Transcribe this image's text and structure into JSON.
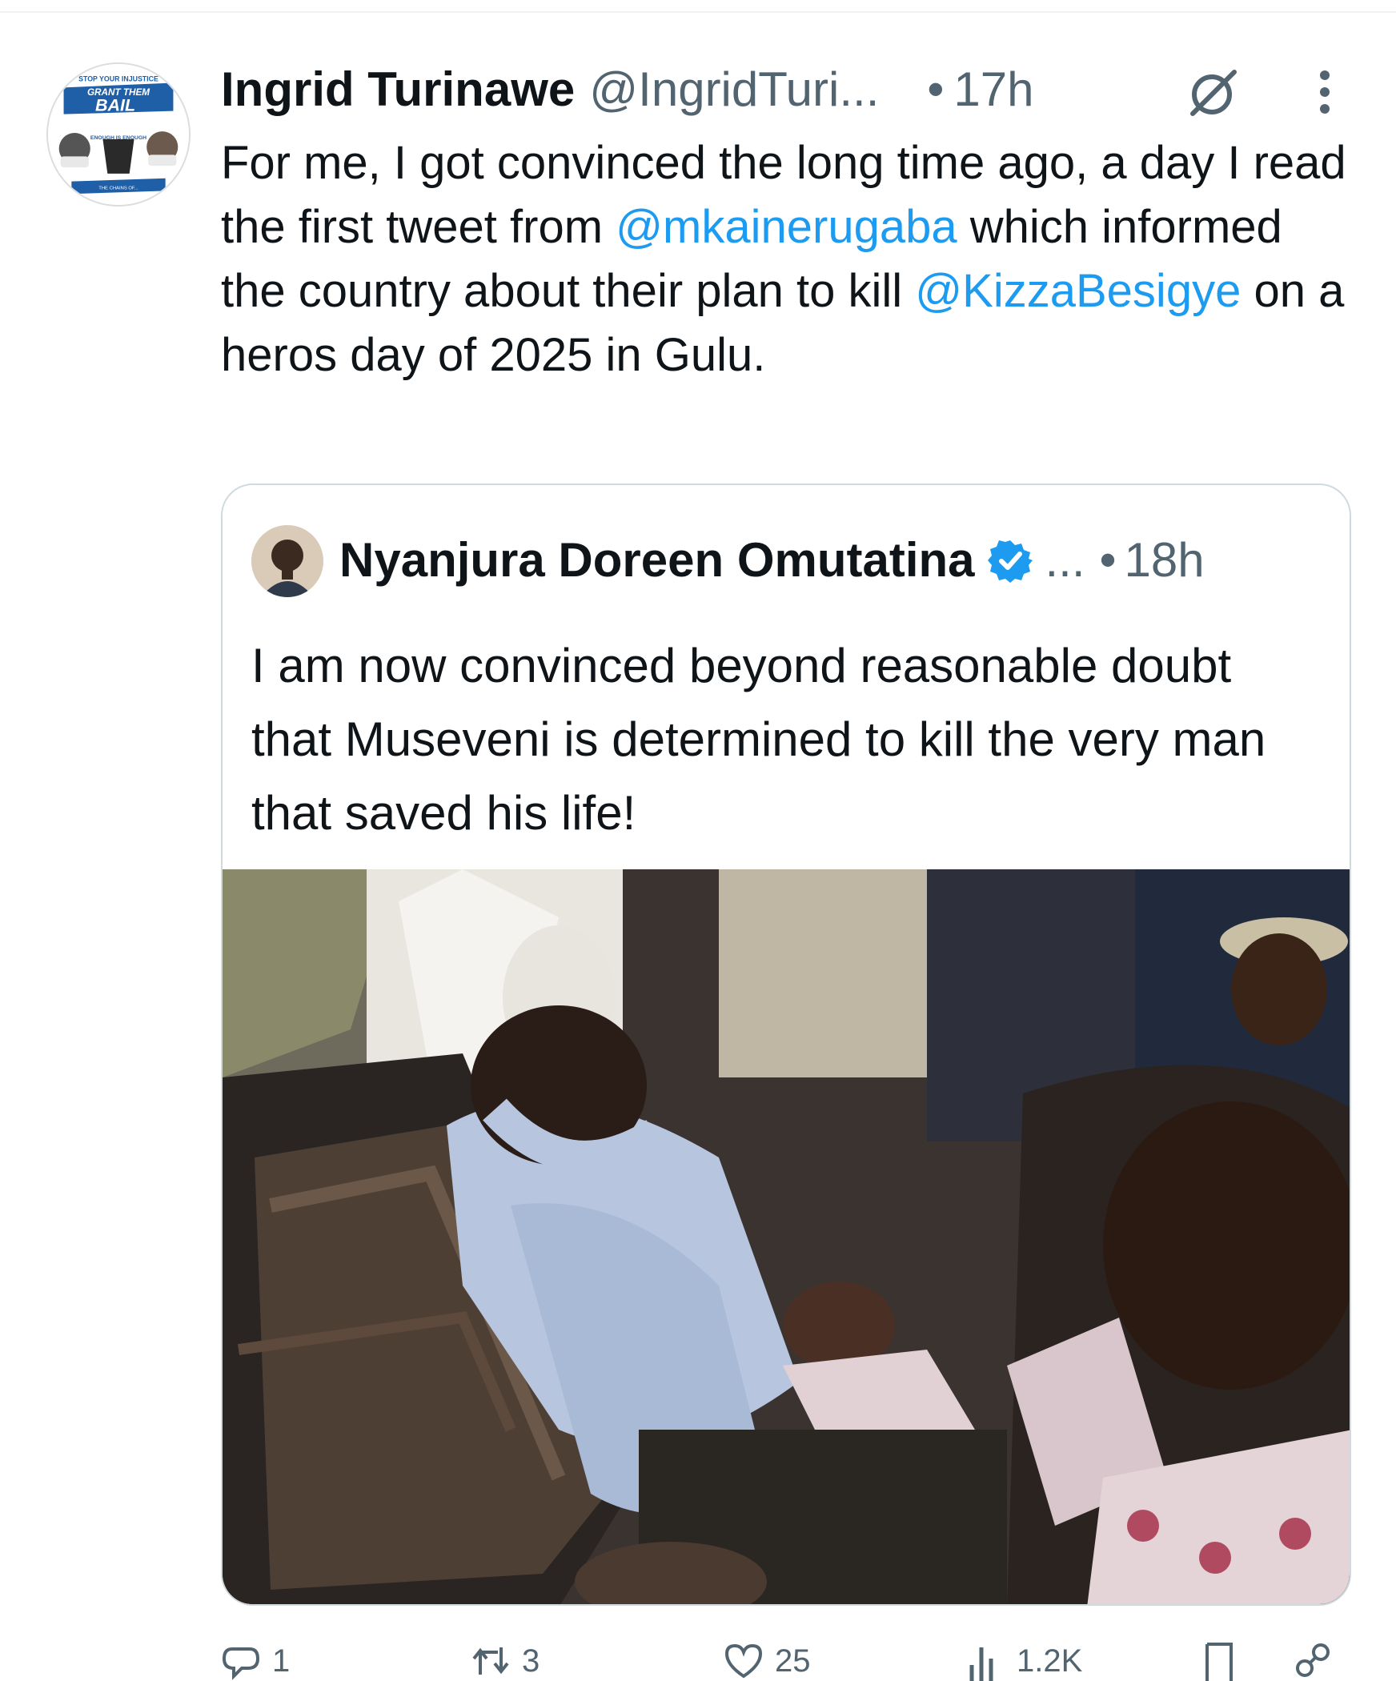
{
  "tweet": {
    "display_name": "Ingrid Turinawe",
    "handle": "@IngridTuri...",
    "separator": "•",
    "time": "17h",
    "text_part1": "For me, I got convinced the long time ago, a day I read the first tweet from ",
    "mention1": "@mkainerugaba",
    "text_part2": " which informed the country about their plan to kill ",
    "mention2": "@KizzaBesigye",
    "text_part3": " on a heros day of 2025 in Gulu.",
    "avatar_text": {
      "top": "STOP YOUR INJUSTICE",
      "line1": "GRANT THEM",
      "line2": "BAIL",
      "middle": "ENOUGH IS ENOUGH",
      "bottom": "THE CHAINS OF..."
    }
  },
  "quote": {
    "display_name": "Nyanjura Doreen Omutatina",
    "ellipsis": "...",
    "separator": "•",
    "time": "18h",
    "text": "I am now convinced beyond reasonable doubt that Museveni is determined to kill the very man that saved his life!"
  },
  "actions": {
    "reply_count": "1",
    "retweet_count": "3",
    "like_count": "25",
    "views_count": "1.2K"
  },
  "colors": {
    "text": "#0f1419",
    "secondary": "#536471",
    "link": "#1d9bf0",
    "border": "#cfd9de"
  },
  "icons": {
    "grok": "grok-icon",
    "more": "more-icon",
    "verified": "verified-badge-icon",
    "reply": "reply-icon",
    "retweet": "retweet-icon",
    "like": "heart-icon",
    "views": "views-icon",
    "bookmark": "bookmark-icon",
    "share": "share-icon"
  }
}
